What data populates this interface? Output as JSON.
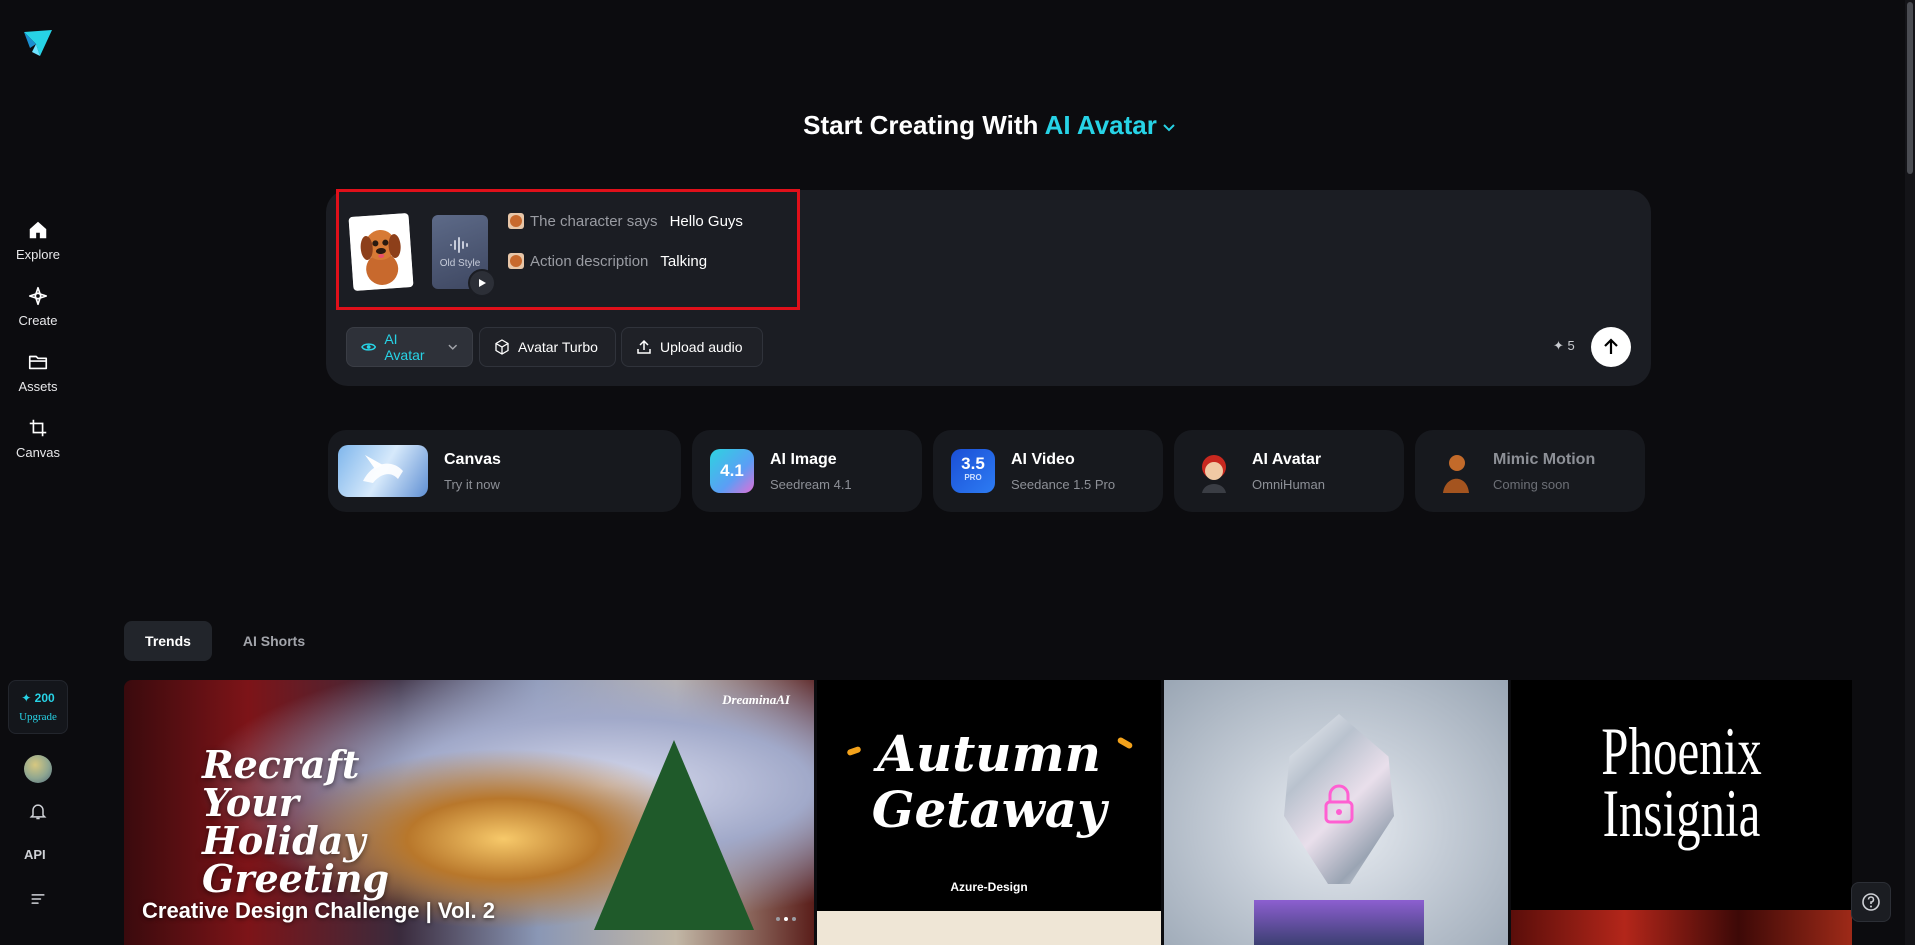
{
  "sidebar": {
    "items": [
      {
        "label": "Explore",
        "icon": "home-icon"
      },
      {
        "label": "Create",
        "icon": "sparkle-icon"
      },
      {
        "label": "Assets",
        "icon": "folder-icon"
      },
      {
        "label": "Canvas",
        "icon": "crop-icon"
      }
    ],
    "credits": "✦ 200",
    "upgrade_label": "Upgrade",
    "api_label": "API"
  },
  "heading": {
    "prefix": "Start Creating With",
    "mode": "AI Avatar"
  },
  "prompt": {
    "audio_thumb_label": "Old Style",
    "lines": [
      {
        "label": "The character says",
        "value": "Hello Guys"
      },
      {
        "label": "Action description",
        "value": "Talking"
      }
    ]
  },
  "toolbar": {
    "mode_label": "AI Avatar",
    "model_label": "Avatar Turbo",
    "upload_label": "Upload audio",
    "cost": "5"
  },
  "features": [
    {
      "title": "Canvas",
      "subtitle": "Try it now"
    },
    {
      "title": "AI Image",
      "subtitle": "Seedream 4.1",
      "badge": "4.1"
    },
    {
      "title": "AI Video",
      "subtitle": "Seedance 1.5 Pro",
      "badge": "3.5",
      "badge_sub": "PRO"
    },
    {
      "title": "AI Avatar",
      "subtitle": "OmniHuman"
    },
    {
      "title": "Mimic Motion",
      "subtitle": "Coming soon"
    }
  ],
  "tabs": [
    {
      "label": "Trends",
      "active": true
    },
    {
      "label": "AI Shorts",
      "active": false
    }
  ],
  "gallery": [
    {
      "brand": "DreaminaAI",
      "art_text": "Recraft Your Holiday Greeting",
      "caption": "Creative Design Challenge | Vol. 2"
    },
    {
      "art_text_line1": "Autumn",
      "art_text_line2": "Getaway",
      "sub": "Azure-Design"
    },
    {
      "art_text": ""
    },
    {
      "art_text_line1": "Phoenix",
      "art_text_line2": "Insignia"
    }
  ],
  "colors": {
    "accent": "#27d3e6",
    "background": "#0c0c0f",
    "card": "#1b1d23",
    "highlight": "#e0101a"
  }
}
